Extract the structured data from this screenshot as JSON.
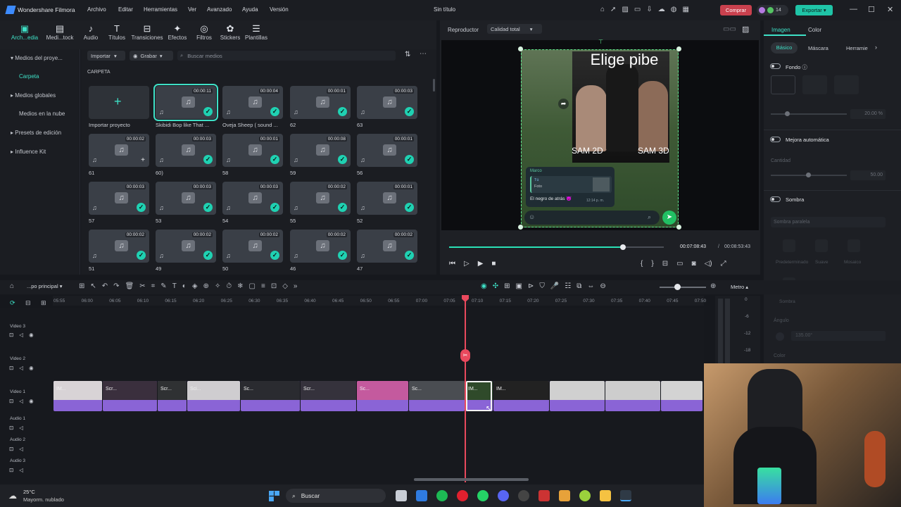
{
  "app": {
    "name": "Wondershare Filmora",
    "doc_title": "Sin título",
    "buy": "Comprar",
    "export": "Exportar",
    "credits": "14"
  },
  "menu": [
    "Archivo",
    "Editar",
    "Herramientas",
    "Ver",
    "Avanzado",
    "Ayuda",
    "Versión"
  ],
  "tools": [
    {
      "label": "Arch...edia",
      "icon": "▣"
    },
    {
      "label": "Medi...tock",
      "icon": "▤"
    },
    {
      "label": "Audio",
      "icon": "♪"
    },
    {
      "label": "Títulos",
      "icon": "T"
    },
    {
      "label": "Transiciones",
      "icon": "⊟"
    },
    {
      "label": "Efectos",
      "icon": "✦"
    },
    {
      "label": "Filtros",
      "icon": "◎"
    },
    {
      "label": "Stickers",
      "icon": "✿"
    },
    {
      "label": "Plantillas",
      "icon": "☰"
    }
  ],
  "sidebar": {
    "items": [
      "Medios del proye...",
      "Carpeta",
      "Medios globales",
      "Medios en la nube",
      "Presets de edición",
      "Influence Kit"
    ]
  },
  "media": {
    "import": "Importar",
    "record": "Grabar",
    "search_placeholder": "Buscar medios",
    "folder": "CARPETA",
    "import_project": "Importar proyecto",
    "tiles": [
      {
        "dur": "00:00:11",
        "label": "Skibidi Bop like That ..."
      },
      {
        "dur": "00:00:04",
        "label": "Oveja   Sheep ( sound ..."
      },
      {
        "dur": "00:00:01",
        "label": "62"
      },
      {
        "dur": "00:00:03",
        "label": "63"
      },
      {
        "dur": "00:00:02",
        "label": "61"
      },
      {
        "dur": "00:00:03",
        "label": "60)"
      },
      {
        "dur": "00:00:01",
        "label": "58"
      },
      {
        "dur": "00:00:08",
        "label": "59"
      },
      {
        "dur": "00:00:01",
        "label": "56"
      },
      {
        "dur": "00:00:03",
        "label": "57"
      },
      {
        "dur": "00:00:03",
        "label": "53"
      },
      {
        "dur": "00:00:03",
        "label": "54"
      },
      {
        "dur": "00:00:02",
        "label": "55"
      },
      {
        "dur": "00:00:01",
        "label": "52"
      },
      {
        "dur": "00:00:02",
        "label": "51"
      },
      {
        "dur": "00:00:02",
        "label": "49"
      },
      {
        "dur": "00:00:02",
        "label": "50"
      },
      {
        "dur": "00:00:02",
        "label": "46"
      },
      {
        "dur": "00:00:02",
        "label": "47"
      }
    ]
  },
  "player": {
    "label": "Reproductor",
    "quality": "Calidad total",
    "overlay_title": "Elige pibe",
    "left_caption": "SAM 2D",
    "right_caption": "SAM 3D",
    "chat_name": "Marco",
    "chat_sub": "Tú",
    "chat_photo": "Foto",
    "chat_msg": "El negro de atrás 😈",
    "chat_time": "12:14 p. m.",
    "current_time": "00:07:08:43",
    "sep": "/",
    "total_time": "00:08:53:43",
    "progress": 0.81
  },
  "inspector": {
    "tabs": [
      "Imagen",
      "Color"
    ],
    "subtabs": [
      "Básico",
      "Máscara",
      "Herramie"
    ],
    "fondo": "Fondo",
    "fondo_val": "20.00",
    "fondo_unit": "%",
    "mejora": "Mejora automática",
    "cantidad": "Cantidad",
    "cantidad_val": "50.00",
    "sombra": "Sombra",
    "sombra_sel": "Sombra paralela",
    "presets": [
      "Predeterminado",
      "Suave",
      "Mosaico"
    ],
    "sombra_preset": "Sombra",
    "angulo": "Ángulo",
    "angulo_val": "135.00°",
    "color": "Color"
  },
  "timeline": {
    "sequence": "...po principal",
    "scale": "Metro",
    "ticks": [
      "05:55",
      "06:00",
      "06:05",
      "06:10",
      "06:15",
      "06:20",
      "06:25",
      "06:30",
      "06:35",
      "06:40",
      "06:45",
      "06:50",
      "06:55",
      "07:00",
      "07:05",
      "07:10",
      "07:15",
      "07:20",
      "07:25",
      "07:30",
      "07:35",
      "07:40",
      "07:45",
      "07:50"
    ],
    "tracks": [
      "Video 3",
      "Video 2",
      "Video 1",
      "Audio 1",
      "Audio 2",
      "Audio 3"
    ],
    "meter": [
      "0",
      "-6",
      "-12",
      "-18"
    ],
    "clip_captions": [
      "IM...",
      "Scr...",
      "Scr...",
      "Sci...",
      "Sc...",
      "Scr...",
      "Sc...",
      "Sc...",
      "IM...",
      "IM..."
    ]
  },
  "taskbar": {
    "temp": "25°C",
    "weather": "Mayorm. nublado",
    "search": "Buscar"
  }
}
